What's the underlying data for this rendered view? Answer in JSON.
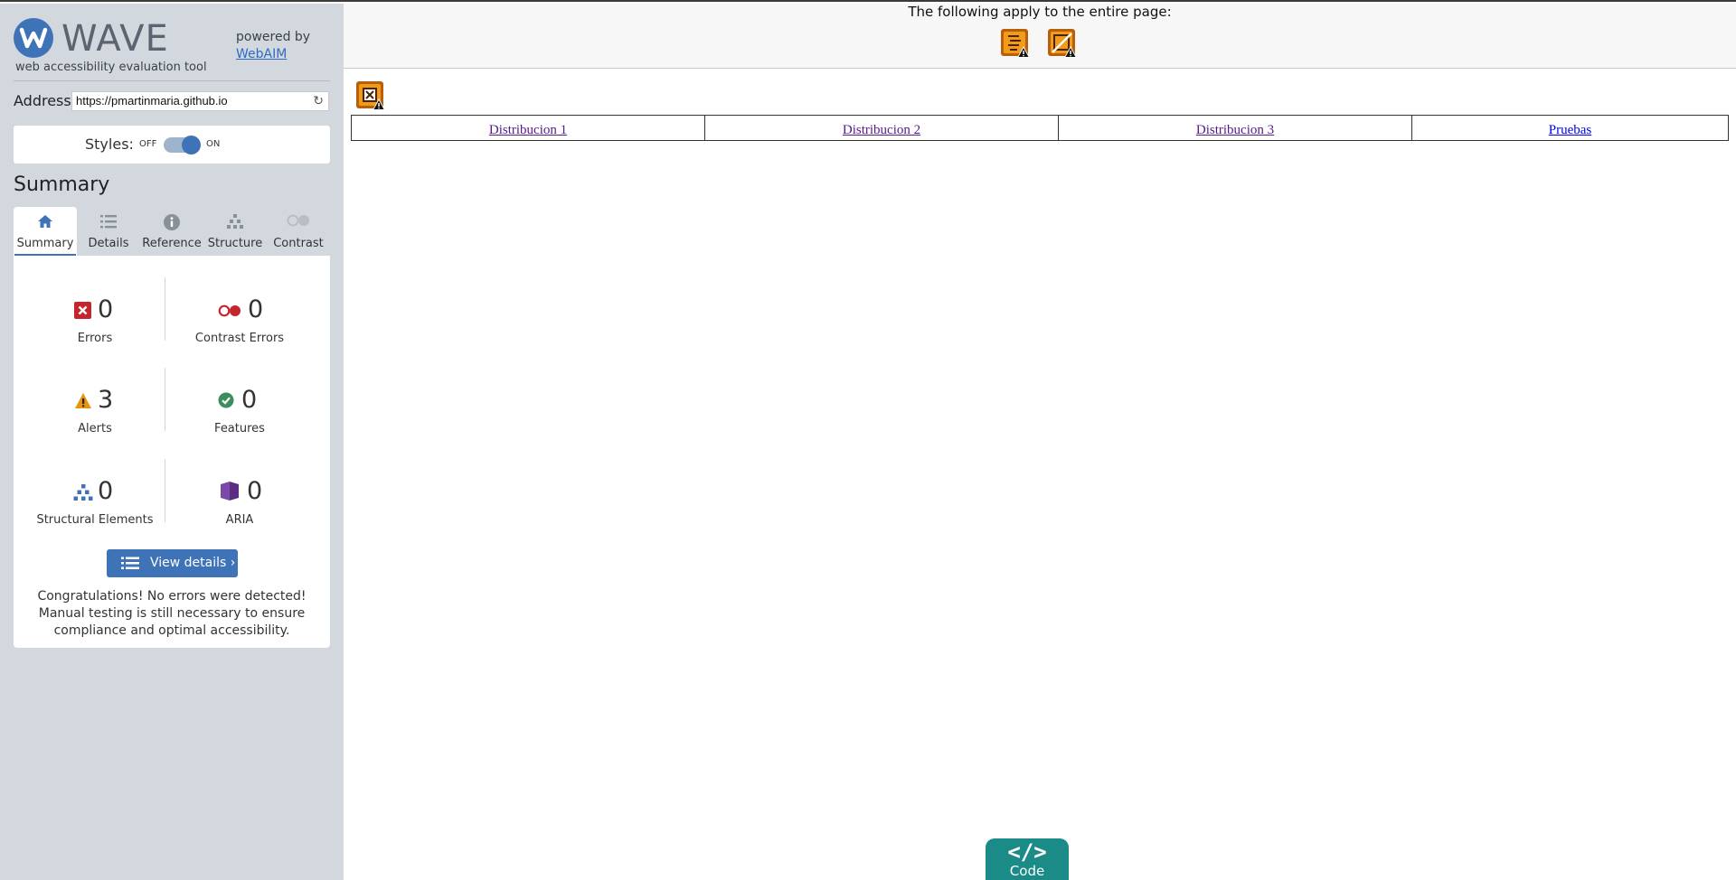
{
  "sidebar": {
    "logo_text": "WAVE",
    "logo_subtitle": "web accessibility evaluation tool",
    "powered_by": "powered by",
    "powered_link": "WebAIM",
    "address_label": "Address:",
    "address_value": "https://pmartinmaria.github.io",
    "styles_label": "Styles:",
    "styles_off": "OFF",
    "styles_on": "ON",
    "styles_state": "ON",
    "summary_title": "Summary",
    "tabs": [
      {
        "label": "Summary",
        "icon": "home-icon",
        "active": true
      },
      {
        "label": "Details",
        "icon": "list-icon",
        "active": false
      },
      {
        "label": "Reference",
        "icon": "info-icon",
        "active": false
      },
      {
        "label": "Structure",
        "icon": "structure-icon",
        "active": false
      },
      {
        "label": "Contrast",
        "icon": "contrast-icon",
        "active": false
      }
    ],
    "stats": {
      "errors": {
        "value": "0",
        "label": "Errors",
        "icon": "error-icon"
      },
      "contrast_errors": {
        "value": "0",
        "label": "Contrast Errors",
        "icon": "contrast-error-icon"
      },
      "alerts": {
        "value": "3",
        "label": "Alerts",
        "icon": "alert-icon"
      },
      "features": {
        "value": "0",
        "label": "Features",
        "icon": "feature-icon"
      },
      "structural": {
        "value": "0",
        "label": "Structural Elements",
        "icon": "structure-icon"
      },
      "aria": {
        "value": "0",
        "label": "ARIA",
        "icon": "aria-icon"
      }
    },
    "view_details": "View details ›",
    "congrats": "Congratulations! No errors were detected! Manual testing is still necessary to ensure compliance and optimal accessibility."
  },
  "main": {
    "page_notice": "The following apply to the entire page:",
    "page_icons": [
      "missing-title-alert-icon",
      "no-heading-structure-alert-icon"
    ],
    "inline_icon": "linked-image-missing-alt-alert-icon",
    "nav_links": [
      {
        "label": "Distribucion 1",
        "color": "#551a8b"
      },
      {
        "label": "Distribucion 2",
        "color": "#551a8b"
      },
      {
        "label": "Distribucion 3",
        "color": "#551a8b"
      },
      {
        "label": "Pruebas",
        "color": "#0000ee"
      }
    ],
    "code_button": {
      "icon": "</>",
      "label": "Code"
    }
  },
  "colors": {
    "sidebar_bg": "#d3d8de",
    "accent_blue": "#3f73b7",
    "code_teal": "#1b8b88",
    "error_red": "#c4262e",
    "alert_orange": "#e8930c",
    "feature_green": "#3c8c5e",
    "aria_purple": "#5a2d83"
  }
}
